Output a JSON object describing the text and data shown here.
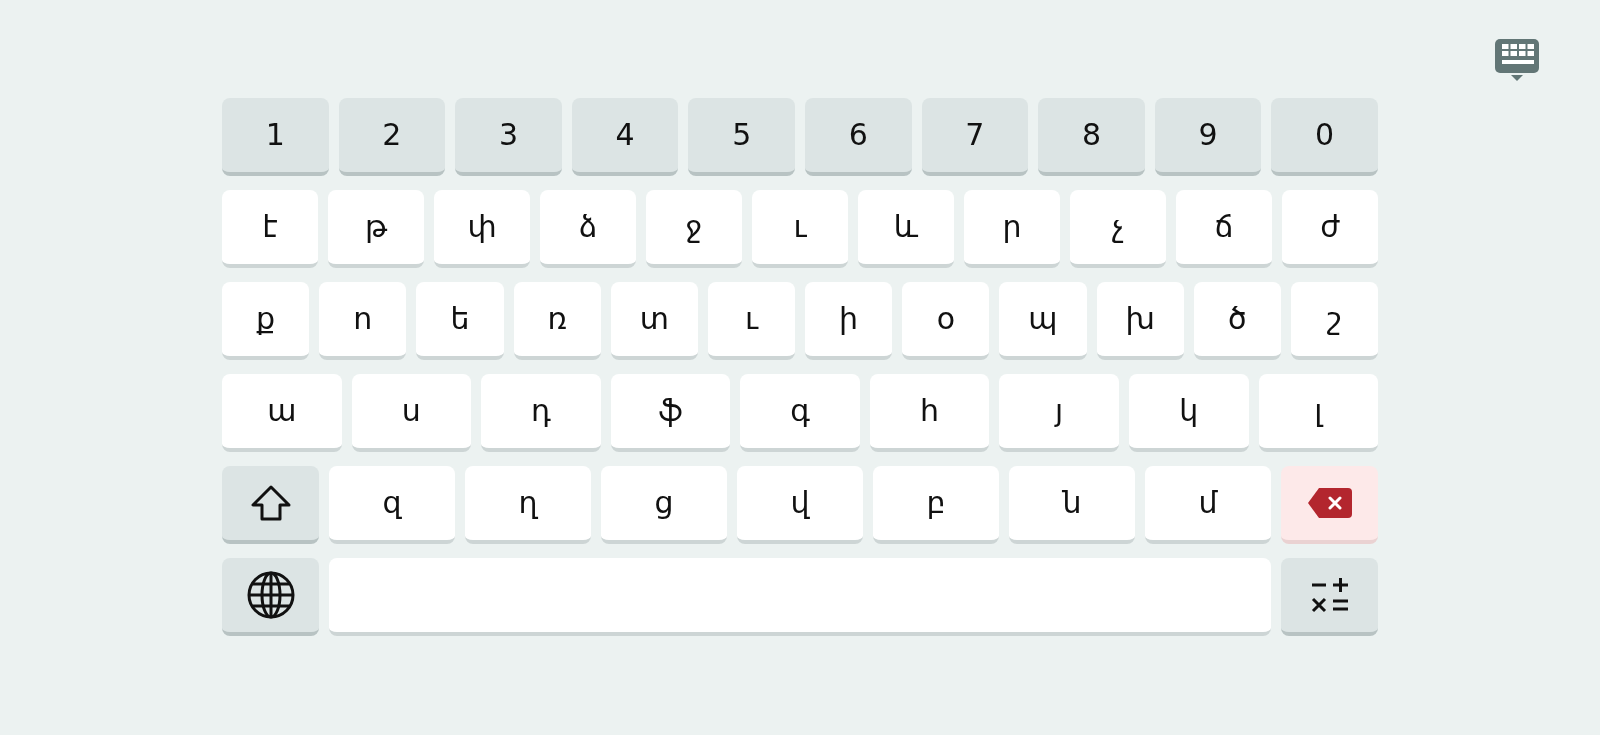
{
  "rows": [
    [
      {
        "kind": "digit",
        "label": "1"
      },
      {
        "kind": "digit",
        "label": "2"
      },
      {
        "kind": "digit",
        "label": "3"
      },
      {
        "kind": "digit",
        "label": "4"
      },
      {
        "kind": "digit",
        "label": "5"
      },
      {
        "kind": "digit",
        "label": "6"
      },
      {
        "kind": "digit",
        "label": "7"
      },
      {
        "kind": "digit",
        "label": "8"
      },
      {
        "kind": "digit",
        "label": "9"
      },
      {
        "kind": "digit",
        "label": "0"
      }
    ],
    [
      {
        "kind": "letter",
        "label": "է"
      },
      {
        "kind": "letter",
        "label": "թ"
      },
      {
        "kind": "letter",
        "label": "փ"
      },
      {
        "kind": "letter",
        "label": "ձ"
      },
      {
        "kind": "letter",
        "label": "ջ"
      },
      {
        "kind": "letter",
        "label": "ւ"
      },
      {
        "kind": "letter",
        "label": "և"
      },
      {
        "kind": "letter",
        "label": "ր"
      },
      {
        "kind": "letter",
        "label": "չ"
      },
      {
        "kind": "letter",
        "label": "ճ"
      },
      {
        "kind": "letter",
        "label": "ժ"
      }
    ],
    [
      {
        "kind": "letter",
        "label": "ք"
      },
      {
        "kind": "letter",
        "label": "ո"
      },
      {
        "kind": "letter",
        "label": "ե"
      },
      {
        "kind": "letter",
        "label": "ռ"
      },
      {
        "kind": "letter",
        "label": "տ"
      },
      {
        "kind": "letter",
        "label": "ւ"
      },
      {
        "kind": "letter",
        "label": "ի"
      },
      {
        "kind": "letter",
        "label": "օ"
      },
      {
        "kind": "letter",
        "label": "պ"
      },
      {
        "kind": "letter",
        "label": "խ"
      },
      {
        "kind": "letter",
        "label": "ծ"
      },
      {
        "kind": "letter",
        "label": "շ"
      }
    ],
    [
      {
        "kind": "letter",
        "label": "ա"
      },
      {
        "kind": "letter",
        "label": "ս"
      },
      {
        "kind": "letter",
        "label": "դ"
      },
      {
        "kind": "letter",
        "label": "ֆ"
      },
      {
        "kind": "letter",
        "label": "գ"
      },
      {
        "kind": "letter",
        "label": "հ"
      },
      {
        "kind": "letter",
        "label": "յ"
      },
      {
        "kind": "letter",
        "label": "կ"
      },
      {
        "kind": "letter",
        "label": "լ"
      }
    ],
    [
      {
        "kind": "shift",
        "on": false
      },
      {
        "kind": "letter",
        "label": "զ"
      },
      {
        "kind": "letter",
        "label": "ղ"
      },
      {
        "kind": "letter",
        "label": "ց"
      },
      {
        "kind": "letter",
        "label": "վ"
      },
      {
        "kind": "letter",
        "label": "բ"
      },
      {
        "kind": "letter",
        "label": "ն"
      },
      {
        "kind": "letter",
        "label": "մ"
      },
      {
        "kind": "backspace"
      }
    ],
    [
      {
        "kind": "globe"
      },
      {
        "kind": "space"
      },
      {
        "kind": "symbols"
      }
    ]
  ]
}
